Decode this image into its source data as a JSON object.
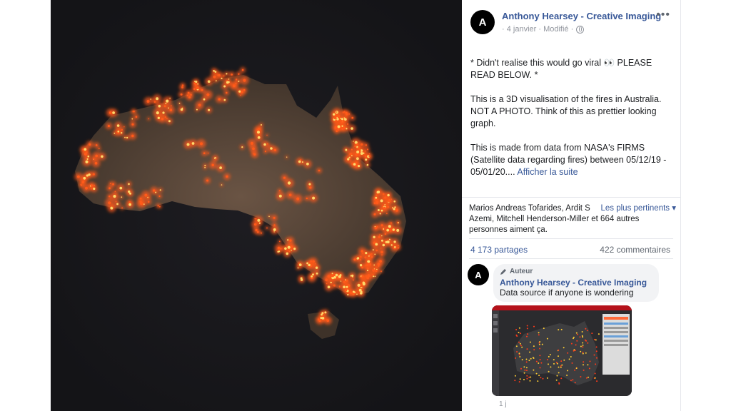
{
  "post": {
    "avatar_letter": "A",
    "author": "Anthony Hearsey - Creative Imaging",
    "date": "· 4 janvier · Modifié ·",
    "more_icon": "•••",
    "paragraph1": "* Didn't realise this would go viral 👀 PLEASE READ BELOW. *",
    "paragraph2": "This is a 3D visualisation of the fires in Australia. NOT A PHOTO. Think of this as prettier looking graph.",
    "paragraph3": "This is made from data from NASA's FIRMS (Satellite data regarding fires) between 05/12/19 - 05/01/20....",
    "see_more": "Afficher la suite"
  },
  "reactions": {
    "text": "Marios Andreas Tofarides, Ardit S Azemi, Mitchell Henderson-Miller et 664 autres personnes aiment ça.",
    "sort_label": "Les plus pertinents ▾",
    "shares": "4 173 partages",
    "comments": "422 commentaires"
  },
  "comment": {
    "avatar_letter": "A",
    "badge": "Auteur",
    "author": "Anthony Hearsey - Creative Imaging",
    "text": "Data source if anyone is wondering",
    "time": "1 j"
  },
  "colors": {
    "link": "#385898",
    "fire": "#ff5a1a",
    "fire_hot": "#ffd86a",
    "land": "#5a4638"
  }
}
